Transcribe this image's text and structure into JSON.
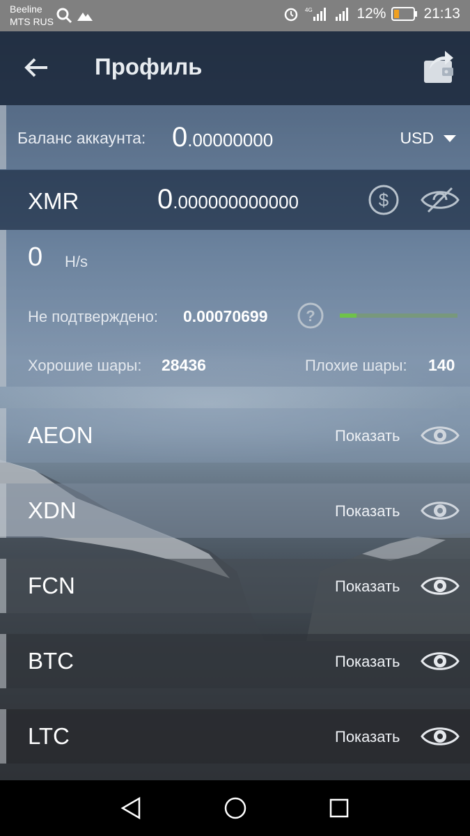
{
  "status_bar": {
    "carrier_1": "Beeline",
    "carrier_2": "MTS RUS",
    "network": "4G",
    "battery": "12%",
    "time": "21:13"
  },
  "header": {
    "title": "Профиль",
    "icons": [
      "back-arrow-icon",
      "wallet-share-icon"
    ]
  },
  "balance": {
    "label": "Баланс аккаунта:",
    "value_int": "0",
    "value_frac": ".00000000",
    "currency": "USD"
  },
  "xmr": {
    "symbol": "XMR",
    "value_int": "0",
    "value_frac": ".000000000000",
    "hashrate": "0",
    "hashrate_unit": "H/s",
    "unconfirmed_label": "Не подтверждено:",
    "unconfirmed_value": "0.00070699",
    "progress": 0.14,
    "good_shares_label": "Хорошие шары:",
    "good_shares": "28436",
    "bad_shares_label": "Плохие шары:",
    "bad_shares": "140"
  },
  "coins": [
    {
      "symbol": "AEON",
      "action": "Показать"
    },
    {
      "symbol": "XDN",
      "action": "Показать"
    },
    {
      "symbol": "FCN",
      "action": "Показать"
    },
    {
      "symbol": "BTC",
      "action": "Показать"
    },
    {
      "symbol": "LTC",
      "action": "Показать"
    }
  ],
  "colors": {
    "accent_green": "#6fc24a",
    "status_bar": "#808080",
    "battery_low": "#f0a020"
  }
}
